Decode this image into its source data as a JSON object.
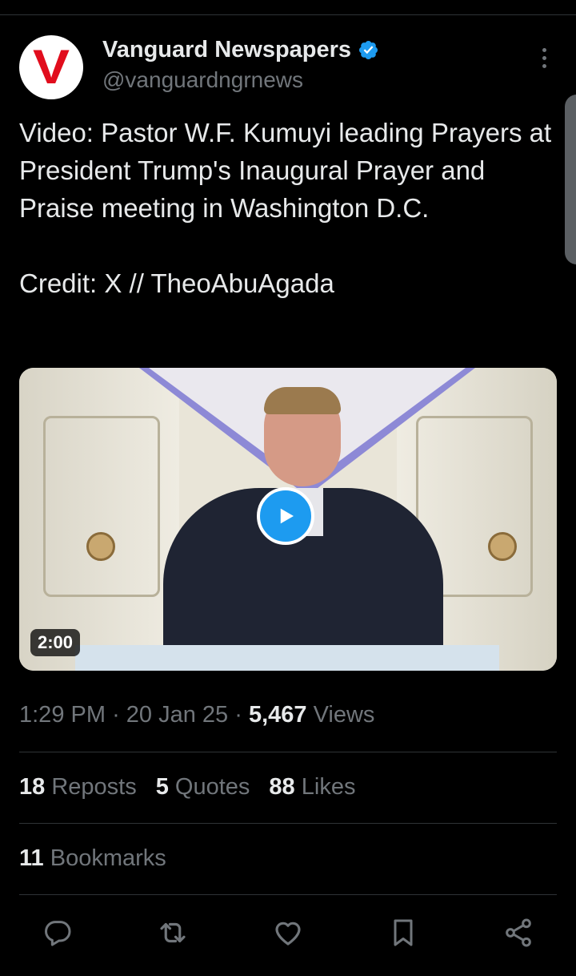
{
  "account": {
    "name": "Vanguard Newspapers",
    "handle": "@vanguardngrnews",
    "avatar_letter": "V"
  },
  "tweet": {
    "text": "Video: Pastor W.F. Kumuyi leading Prayers at President Trump's Inaugural Prayer and Praise meeting in Washington D.C.\n\nCredit: X // TheoAbuAgada"
  },
  "media": {
    "duration": "2:00"
  },
  "meta": {
    "time": "1:29 PM",
    "date": "20 Jan 25",
    "views_count": "5,467",
    "views_label": "Views"
  },
  "stats": {
    "reposts_count": "18",
    "reposts_label": "Reposts",
    "quotes_count": "5",
    "quotes_label": "Quotes",
    "likes_count": "88",
    "likes_label": "Likes",
    "bookmarks_count": "11",
    "bookmarks_label": "Bookmarks"
  },
  "icons": {
    "verified": "verified-badge-icon",
    "more": "more-vertical-icon",
    "reply": "reply-icon",
    "repost": "repost-icon",
    "like": "heart-icon",
    "bookmark": "bookmark-icon",
    "share": "share-icon",
    "play": "play-icon"
  },
  "colors": {
    "background": "#000000",
    "text": "#e7e9ea",
    "secondary": "#71767b",
    "accent": "#1d9bf0",
    "brand_red": "#e10d1d"
  }
}
